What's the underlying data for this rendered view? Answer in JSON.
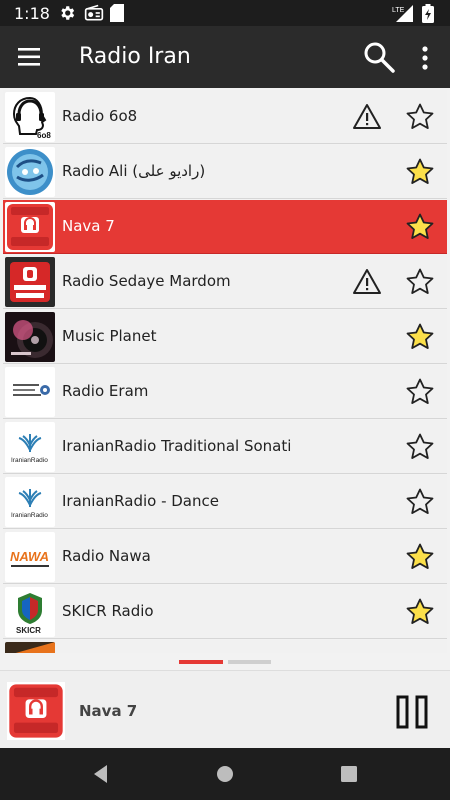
{
  "status_bar": {
    "time": "1:18",
    "network": "LTE"
  },
  "app_bar": {
    "title": "Radio Iran"
  },
  "stations": [
    {
      "name": "Radio 6o8",
      "warning": true,
      "favorite": false,
      "selected": false,
      "logo": "radio-608-logo"
    },
    {
      "name": "Radio Ali (رادیو علی)",
      "warning": false,
      "favorite": true,
      "selected": false,
      "logo": "radio-ali-logo"
    },
    {
      "name": "Nava 7",
      "warning": false,
      "favorite": true,
      "selected": true,
      "logo": "nava7-logo"
    },
    {
      "name": "Radio Sedaye Mardom",
      "warning": true,
      "favorite": false,
      "selected": false,
      "logo": "sedaye-mardom-logo"
    },
    {
      "name": "Music Planet",
      "warning": false,
      "favorite": true,
      "selected": false,
      "logo": "music-planet-logo"
    },
    {
      "name": "Radio Eram",
      "warning": false,
      "favorite": false,
      "selected": false,
      "logo": "radio-eram-logo"
    },
    {
      "name": "IranianRadio Traditional Sonati",
      "warning": false,
      "favorite": false,
      "selected": false,
      "logo": "iranianradio-logo"
    },
    {
      "name": "IranianRadio - Dance",
      "warning": false,
      "favorite": false,
      "selected": false,
      "logo": "iranianradio-logo"
    },
    {
      "name": "Radio Nawa",
      "warning": false,
      "favorite": true,
      "selected": false,
      "logo": "radio-nawa-logo"
    },
    {
      "name": "SKICR Radio",
      "warning": false,
      "favorite": true,
      "selected": false,
      "logo": "skicr-logo"
    }
  ],
  "logo_text": {
    "sixoeight": "6o8",
    "iranianradio": "IranianRadio",
    "nawa": "NAWA",
    "skicr": "SKICR"
  },
  "now_playing": {
    "name": "Nava 7",
    "logo": "nava7-logo"
  },
  "colors": {
    "accent": "#e53935",
    "star_fill": "#fce04a",
    "app_bar": "#2b2b2b"
  }
}
